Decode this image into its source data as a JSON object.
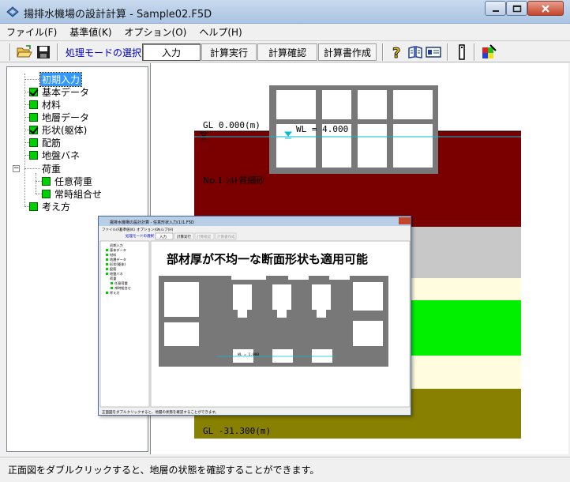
{
  "window": {
    "title": "揚排水機場の設計計算 - Sample02.F5D"
  },
  "menu": [
    "ファイル(F)",
    "基準値(K)",
    "オプション(O)",
    "ヘルプ(H)"
  ],
  "toolbar": {
    "mode_label": "処理モードの選択",
    "buttons": [
      "入力",
      "計算実行",
      "計算確認",
      "計算書作成"
    ]
  },
  "tree": {
    "items": [
      {
        "label": "初期入力",
        "state": "selected"
      },
      {
        "label": "基本データ",
        "state": "checked"
      },
      {
        "label": "材料",
        "state": "green"
      },
      {
        "label": "地層データ",
        "state": "green"
      },
      {
        "label": "形状(躯体)",
        "state": "checked"
      },
      {
        "label": "配筋",
        "state": "green"
      },
      {
        "label": "地盤バネ",
        "state": "green"
      },
      {
        "label": "荷重",
        "state": "folder"
      },
      {
        "label": "任意荷重",
        "state": "green"
      },
      {
        "label": "常時組合せ",
        "state": "green"
      },
      {
        "label": "考え方",
        "state": "green"
      }
    ]
  },
  "drawing": {
    "gl_top": "GL   0.000(m)",
    "wl": "WL = 4.000",
    "layer1": "No.1 ｼﾙﾄ質細砂",
    "gl_bottom": "GL  -31.300(m)",
    "colors": {
      "layer_dark_red": "#7a0000",
      "layer_gray": "#c8c8c8",
      "layer_cream": "#fffce0",
      "layer_green": "#00f000",
      "layer_olive": "#888000",
      "water_line": "#00bcd4",
      "structure": "#787878"
    }
  },
  "inset": {
    "title": "揚排水機場の設計計算 - 任意形状入力(1)1.F5D",
    "caption": "部材厚が不均一な断面形状も適用可能",
    "mode_label": "処理モードの選択",
    "buttons": [
      "入力",
      "計算実行",
      "計算確認",
      "計算書作成"
    ],
    "menu": [
      "ファイル(F)",
      "基準値(K)",
      "オプション(O)",
      "ヘルプ(H)"
    ],
    "tree_items": [
      "初期入力",
      "基本データ",
      "材料",
      "地層データ",
      "形状(躯体)",
      "配筋",
      "地盤バネ",
      "荷重",
      "任意荷重",
      "常時組合せ",
      "考え方"
    ],
    "wl": "WL = 1.000",
    "status": "正面図をダブルクリックすると、地層の状態を確認することができます。"
  },
  "status": {
    "text": "正面図をダブルクリックすると、地層の状態を確認することができます。"
  }
}
